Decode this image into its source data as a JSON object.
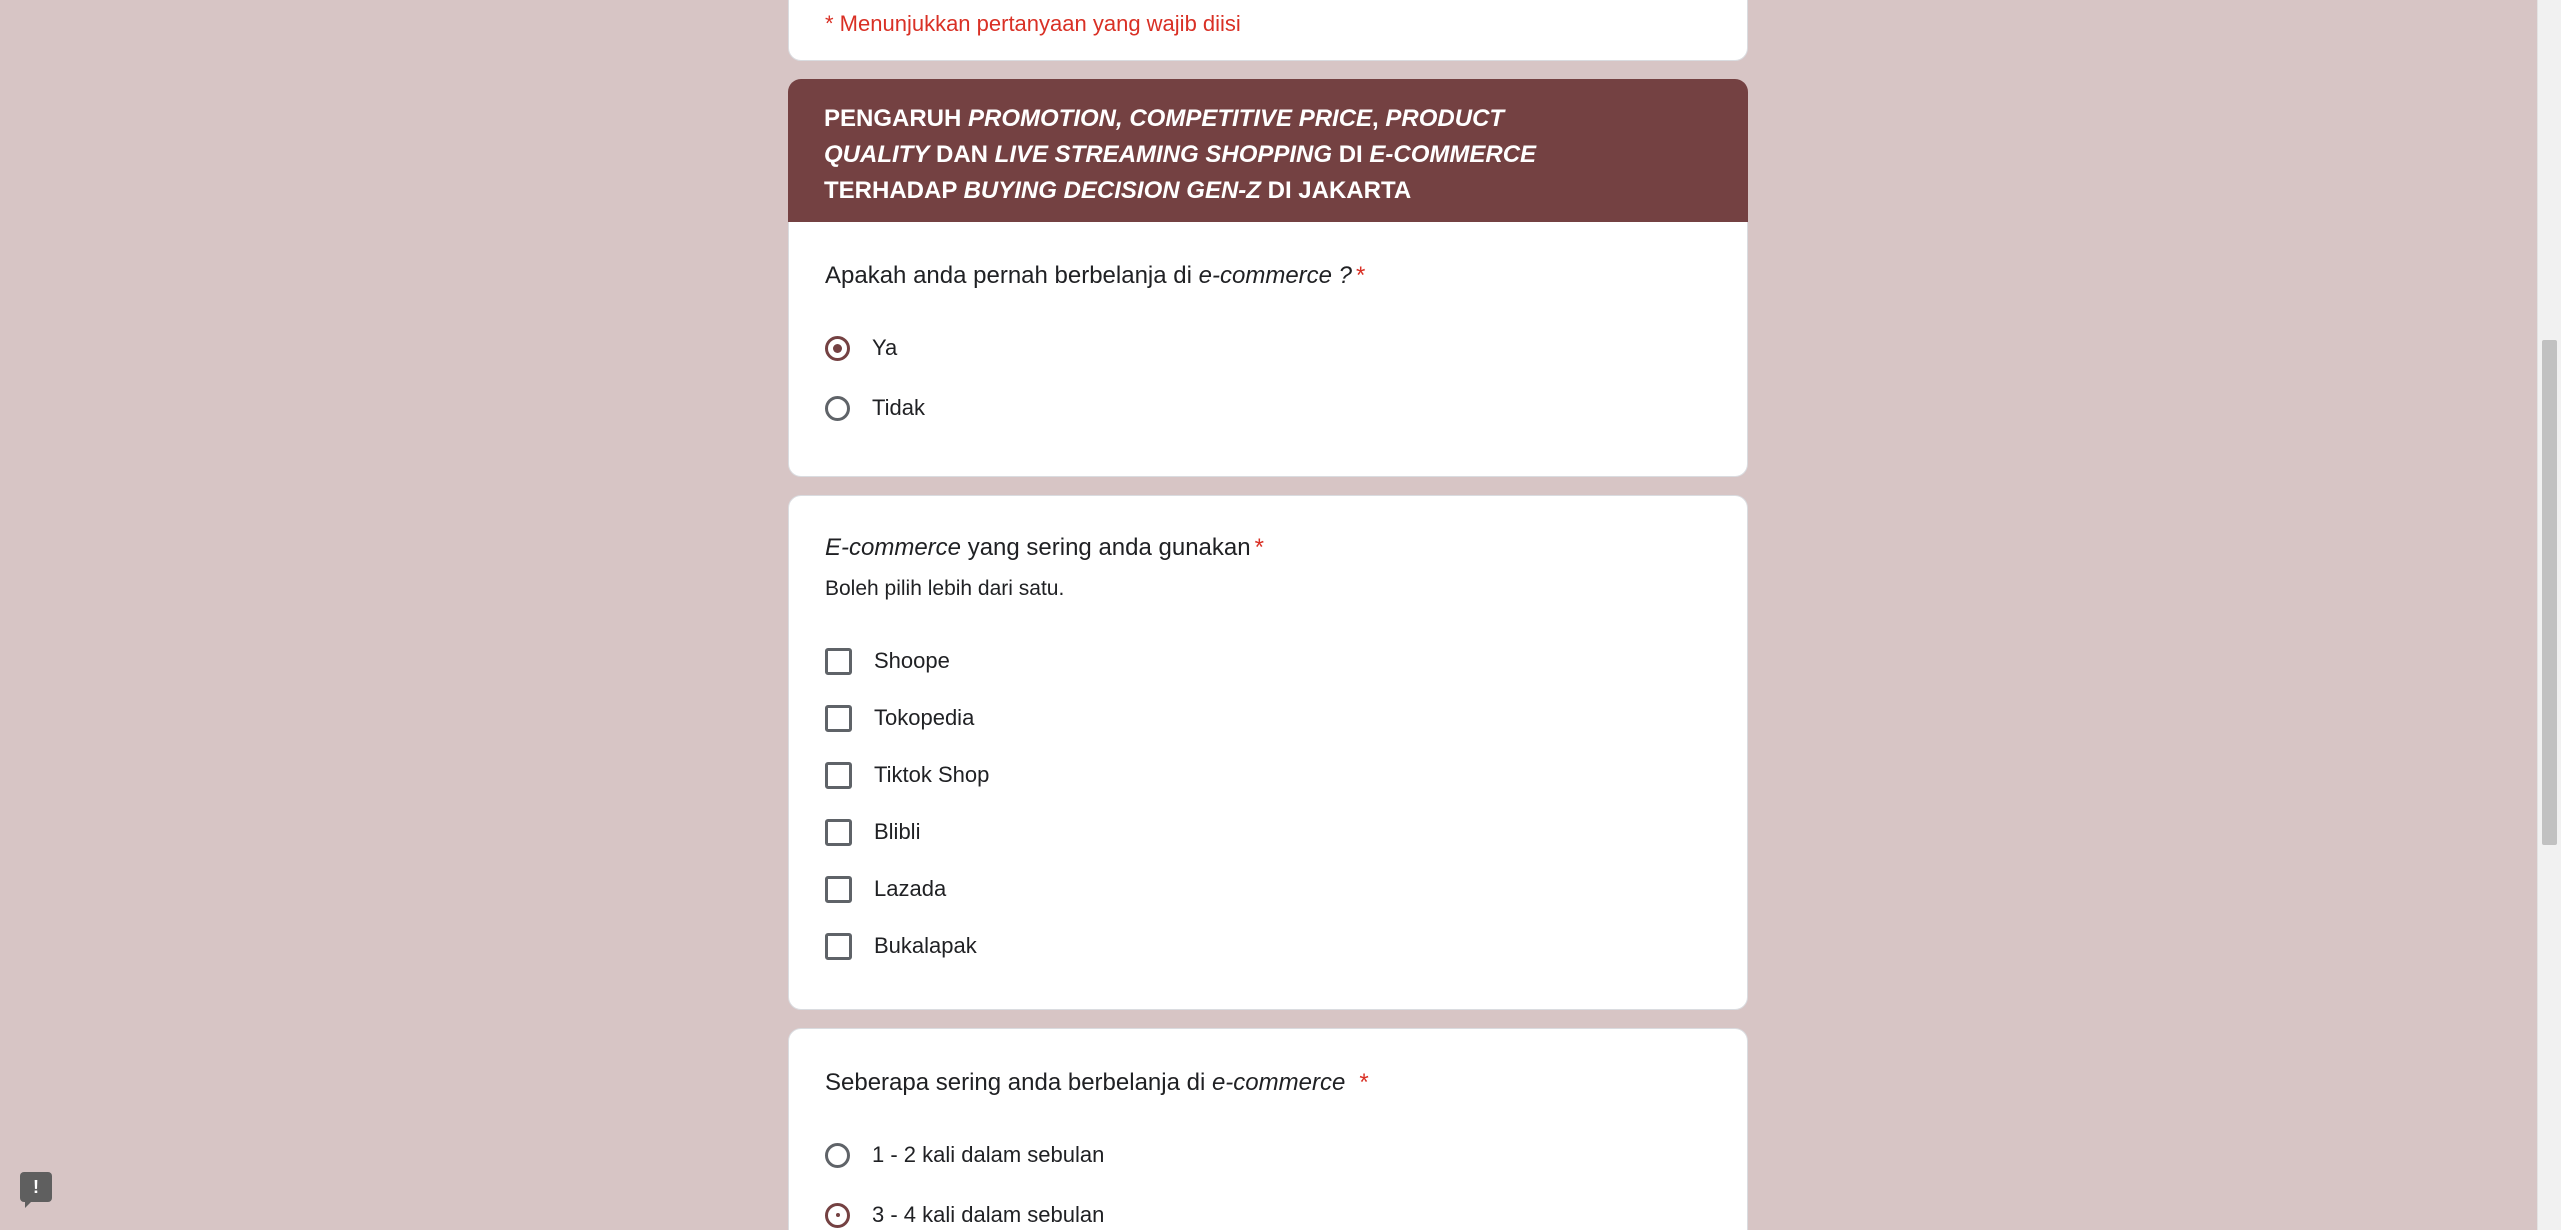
{
  "required_note": "* Menunjukkan pertanyaan yang wajib diisi",
  "section": {
    "title_parts": [
      "PENGARUH ",
      "PROMOTION, COMPETITIVE PRICE",
      ", ",
      "PRODUCT QUALITY",
      " DAN ",
      "LIVE STREAMING SHOPPING",
      " DI ",
      "E-COMMERCE",
      " TERHADAP ",
      "BUYING DECISION GEN-Z",
      " DI JAKARTA"
    ],
    "color": "#744142"
  },
  "q1": {
    "title_a": "Apakah anda pernah berbelanja di ",
    "title_b": "e-commerce ?",
    "star": "*",
    "options": [
      {
        "label": "Ya",
        "selected": true
      },
      {
        "label": "Tidak",
        "selected": false
      }
    ]
  },
  "q2": {
    "title_a": "E-commerce",
    "title_b": " yang sering anda gunakan",
    "star": "*",
    "description": "Boleh pilih lebih dari satu.",
    "options": [
      {
        "label": "Shoope",
        "checked": false
      },
      {
        "label": "Tokopedia",
        "checked": false
      },
      {
        "label": "Tiktok Shop",
        "checked": false
      },
      {
        "label": "Blibli",
        "checked": false
      },
      {
        "label": "Lazada",
        "checked": false
      },
      {
        "label": "Bukalapak",
        "checked": false
      }
    ]
  },
  "q3": {
    "title_a": "Seberapa sering anda berbelanja di ",
    "title_b": "e-commerce",
    "star": "*",
    "options": [
      {
        "label": "1 - 2 kali dalam sebulan",
        "selected": false
      },
      {
        "label": "3 - 4 kali dalam sebulan",
        "selected": true
      }
    ]
  },
  "feedback": {
    "icon": "feedback-icon",
    "glyph": "!"
  }
}
